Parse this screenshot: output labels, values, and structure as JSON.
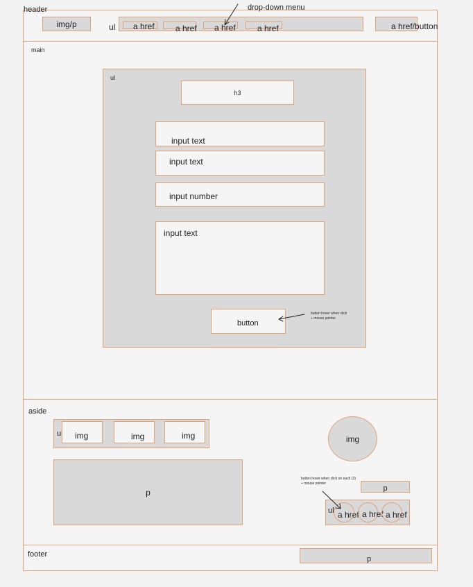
{
  "header": {
    "label": "header",
    "logo": "img/p",
    "nav_label": "ul",
    "nav_links": [
      "a href",
      "a href",
      "a href",
      "a href"
    ],
    "cta": "a href/button",
    "annotation": "drop-down menu"
  },
  "main": {
    "label": "main",
    "form_label": "ul",
    "heading": "h3",
    "fields": {
      "text1": "input text",
      "text2": "input text",
      "number": "input number",
      "textarea": "input text"
    },
    "button": "button",
    "button_note_line1": "button hover when click",
    "button_note_line2": "+ mouse pointer"
  },
  "aside": {
    "label": "aside",
    "gallery_label": "ul",
    "gallery": [
      "img",
      "img",
      "img"
    ],
    "paragraph": "p",
    "avatar": "img",
    "note_line1": "button hover when click on each (3)",
    "note_line2": "+ mouse pointer",
    "small_p": "p",
    "links_label": "ul",
    "links": [
      "a href",
      "a href",
      "a href"
    ]
  },
  "footer": {
    "label": "footer",
    "p": "p"
  }
}
